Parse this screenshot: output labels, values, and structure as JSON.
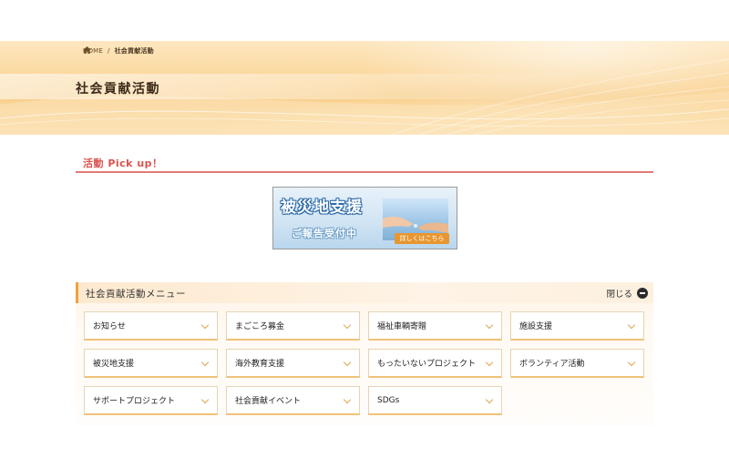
{
  "breadcrumb": {
    "home_label": "HOME",
    "separator": "/",
    "current": "社会貢献活動"
  },
  "page_title": "社会貢献活動",
  "pickup": {
    "title": "活動 Pick up！",
    "banner": {
      "title": "被災地支援",
      "subtitle": "ご報告受付中",
      "button_label": "詳しくはこちら"
    }
  },
  "menu": {
    "title": "社会貢献活動メニュー",
    "close_label": "閉じる",
    "items": [
      {
        "label": "お知らせ"
      },
      {
        "label": "まごころ募金"
      },
      {
        "label": "福祉車輌寄贈"
      },
      {
        "label": "施設支援"
      },
      {
        "label": "被災地支援"
      },
      {
        "label": "海外教育支援"
      },
      {
        "label": "もったいないプロジェクト"
      },
      {
        "label": "ボランティア活動"
      },
      {
        "label": "サポートプロジェクト"
      },
      {
        "label": "社会貢献イベント"
      },
      {
        "label": "SDGs"
      }
    ]
  },
  "colors": {
    "accent_red": "#d9534f",
    "accent_orange": "#f0a23a",
    "hero_gold": "#f9cf8c"
  }
}
